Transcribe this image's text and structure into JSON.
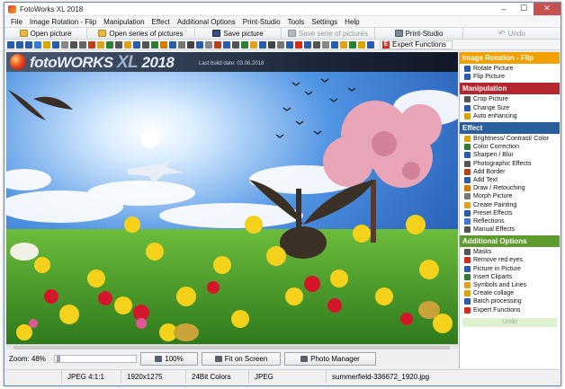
{
  "window": {
    "title": "FotoWorks XL 2018",
    "controls": [
      "–",
      "☐",
      "✕"
    ]
  },
  "menu": [
    "File",
    "Image Rotation - Flip",
    "Manipulation",
    "Effect",
    "Additional Options",
    "Print-Studio",
    "Tools",
    "Settings",
    "Help"
  ],
  "toolbar": {
    "open_picture": "Open picture",
    "open_series": "Open series of pictures",
    "save_picture": "Save picture",
    "save_series": "Save serie of pictures",
    "print_studio": "Print-Studio",
    "undo": "Undo",
    "expert_functions": "Expert Functions",
    "expert_letter": "E"
  },
  "tool_icon_colors": [
    "#2a5caa",
    "#2a5caa",
    "#2a5caa",
    "#3a7bd5",
    "#d9a400",
    "#2a5caa",
    "#888888",
    "#555555",
    "#666666",
    "#b7411c",
    "#e0a21c",
    "#2f7d32",
    "#555555",
    "#e0a21c",
    "#2a5caa",
    "#555555",
    "#2f7d32",
    "#d97a00",
    "#2a5caa",
    "#777777",
    "#444444",
    "#2a5caa",
    "#888888",
    "#b7411c",
    "#2a5caa",
    "#555555",
    "#2f7d32",
    "#e0a21c",
    "#2a5caa",
    "#444444",
    "#777777",
    "#2a5caa",
    "#d52b1e",
    "#2a5caa",
    "#555555",
    "#888888",
    "#2a5caa",
    "#e0a21c",
    "#2f7d32",
    "#d9a400",
    "#2a5caa"
  ],
  "banner": {
    "brand": "fotoWORKS",
    "xl": "XL",
    "year": "2018",
    "build_date": "Last build date: 03.06.2018"
  },
  "bottom": {
    "zoom_label": "Zoom: 48%",
    "btn_100": "100%",
    "btn_fit": "Fit on Screen",
    "btn_manager": "Photo Manager"
  },
  "status": {
    "format": "JPEG  4:1:1",
    "size": "1920x1275",
    "colors": "24Bit Colors",
    "type": "JPEG",
    "filename": "summerfield-336672_1920.jpg"
  },
  "sidebar": {
    "sections": [
      {
        "title": "Image Rotation - Flip",
        "color": "#f2a100",
        "items": [
          {
            "label": "Rotate Picture",
            "icon": "#2a5caa"
          },
          {
            "label": "Flip Picture",
            "icon": "#2a5caa"
          }
        ]
      },
      {
        "title": "Manipulation",
        "color": "#b7262e",
        "items": [
          {
            "label": "Crop Picture",
            "icon": "#555555"
          },
          {
            "label": "Change Size",
            "icon": "#2a5caa"
          },
          {
            "label": "Auto enhancing",
            "icon": "#d9a400"
          }
        ]
      },
      {
        "title": "Effect",
        "color": "#2a5f9e",
        "items": [
          {
            "label": "Brightness/ Contrast/ Color",
            "icon": "#d9a400"
          },
          {
            "label": "Color Correction",
            "icon": "#2f7d32"
          },
          {
            "label": "Sharpen / Blur",
            "icon": "#2a5caa"
          },
          {
            "label": "Photographic Effects",
            "icon": "#555555"
          },
          {
            "label": "Add Border",
            "icon": "#b7411c"
          },
          {
            "label": "Add Text",
            "icon": "#2a5caa"
          },
          {
            "label": "Draw / Retouching",
            "icon": "#d97a00"
          },
          {
            "label": "Morph Picture",
            "icon": "#777777"
          },
          {
            "label": "Create Painting",
            "icon": "#e0a21c"
          },
          {
            "label": "Preset Effects",
            "icon": "#2a5caa"
          },
          {
            "label": "Reflections",
            "icon": "#3a7bd5"
          },
          {
            "label": "Manual Effects",
            "icon": "#555555"
          }
        ]
      },
      {
        "title": "Additional Options",
        "color": "#5f9a2f",
        "items": [
          {
            "label": "Masks",
            "icon": "#555555"
          },
          {
            "label": "Remove red eyes",
            "icon": "#d52b1e"
          },
          {
            "label": "Picture in Picture",
            "icon": "#2a5caa"
          },
          {
            "label": "Insert Cliparts",
            "icon": "#2f7d32"
          },
          {
            "label": "Symbols and Lines",
            "icon": "#e0a21c"
          },
          {
            "label": "Create collage",
            "icon": "#d9a400"
          },
          {
            "label": "Batch processing",
            "icon": "#2a5caa"
          },
          {
            "label": "Expert Functions",
            "icon": "#d52b1e"
          }
        ]
      }
    ],
    "undo_label": "Undo"
  }
}
